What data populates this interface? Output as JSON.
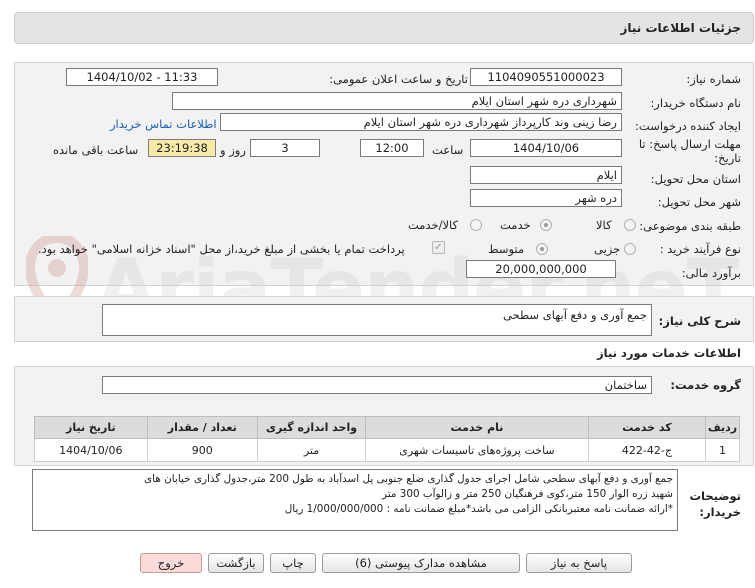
{
  "window_title": "جزئیات اطلاعات نیاز",
  "watermark": "AriaTender.neT",
  "fields": {
    "need_number_label": "شماره نیاز:",
    "need_number": "1104090551000023",
    "announce_label": "تاریخ و ساعت اعلان عمومی:",
    "announce_value": "1404/10/02 - 11:33",
    "buyer_org_label": "نام دستگاه خریدار:",
    "buyer_org": "شهرداری دره شهر استان ایلام",
    "creator_label": "ایجاد کننده درخواست:",
    "creator": "رضا زینی وند کارپرداز شهرداری دره شهر استان ایلام",
    "contact_link": "اطلاعات تماس خریدار",
    "deadline_label": "مهلت ارسال پاسخ: تا تاریخ:",
    "deadline_date": "1404/10/06",
    "time_label": "ساعت",
    "deadline_time": "12:00",
    "days_value": "3",
    "days_label": "روز و",
    "remaining_time": "23:19:38",
    "remaining_label": "ساعت باقی مانده",
    "province_label": "استان محل تحویل:",
    "province": "ایلام",
    "city_label": "شهر محل تحویل:",
    "city": "دره شهر",
    "category_label": "طبقه بندی موضوعی:",
    "category_options": [
      "کالا",
      "خدمت",
      "کالا/خدمت"
    ],
    "process_label": "نوع فرآیند خرید :",
    "process_options": [
      "جزیی",
      "متوسط"
    ],
    "payment_note": "پرداخت تمام یا بخشی از مبلغ خرید،از محل \"اسناد خزانه اسلامی\" خواهد بود.",
    "budget_label": "برآورد مالی:",
    "budget": "20,000,000,000"
  },
  "summary": {
    "label": "شرح کلی نیاز:",
    "value": "جمع آوری و دفع آبهای سطحی"
  },
  "services": {
    "section_title": "اطلاعات خدمات مورد نیاز",
    "group_label": "گروه خدمت:",
    "group_value": "ساختمان",
    "columns": [
      "ردیف",
      "کد خدمت",
      "نام خدمت",
      "واحد اندازه گیری",
      "تعداد / مقدار",
      "تاریخ نیاز"
    ],
    "rows": [
      {
        "row": "1",
        "code": "ج-42-422",
        "name": "ساخت پروژه‌های تاسیسات شهری",
        "unit": "متر",
        "qty": "900",
        "date": "1404/10/06"
      }
    ]
  },
  "buyer_notes": {
    "label": "توضیحات خریدار:",
    "line1": "جمع آوری و دفع آبهای سطحی شامل اجرای جدول گذاری ضلع جنوبی پل اسدآباد به طول 200 متر،جدول گذاری خیابان های",
    "line2": "شهید زره الوار 150 متر،کوی فرهنگیان 250 متر و زالوآب 300 متر",
    "line3": "*ارائه ضمانت نامه معتبربانکی الزامی می باشد*مبلغ ضمانت نامه : 1/000/000/000 ریال"
  },
  "buttons": {
    "reply": "پاسخ به نیاز",
    "attachments": "مشاهده مدارک پیوستی (6)",
    "print": "چاپ",
    "back": "بازگشت",
    "exit": "خروج"
  },
  "colors": {
    "header_bg": "#e4e4e4",
    "panel_bg": "#f2f2f2",
    "remaining_bg": "#f7eaa8",
    "link": "#1a5fb4",
    "exit_bg": "#fbdada",
    "watermark_red": "#e8b6b6"
  }
}
